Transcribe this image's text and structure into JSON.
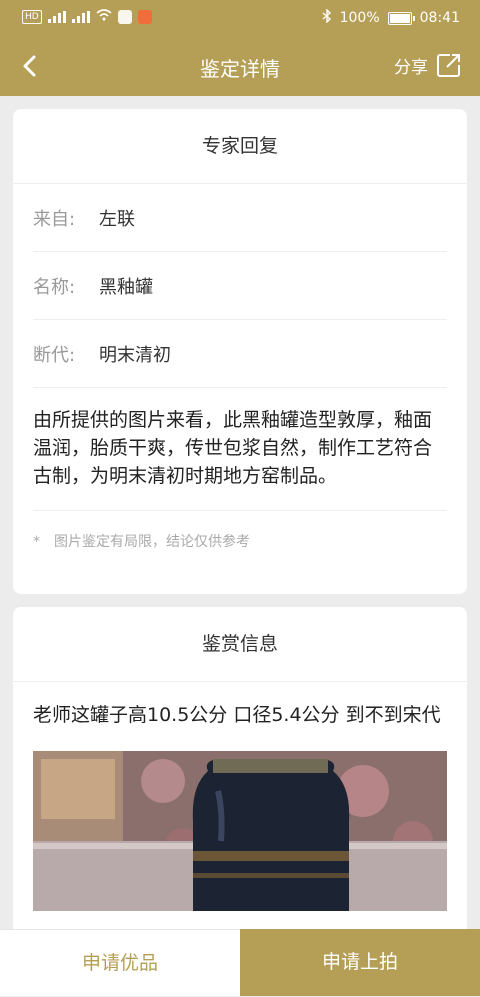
{
  "status_bar": {
    "battery": "100%",
    "time": "08:41",
    "network_label": "4G"
  },
  "header": {
    "title": "鉴定详情",
    "share_label": "分享"
  },
  "expert_reply": {
    "title": "专家回复",
    "rows": [
      {
        "key": "来自:",
        "value": "左联"
      },
      {
        "key": "名称:",
        "value": "黑釉罐"
      },
      {
        "key": "断代:",
        "value": "明末清初"
      }
    ],
    "description": "由所提供的图片来看，此黑釉罐造型敦厚，釉面温润，胎质干爽，传世包浆自然，制作工艺符合古制，为明末清初时期地方窑制品。",
    "note_star": "*",
    "note": "图片鉴定有局限，结论仅供参考"
  },
  "appreciation": {
    "title": "鉴赏信息",
    "question": "老师这罐子高10.5公分 口径5.4公分 到不到宋代"
  },
  "bottom_bar": {
    "left_label": "申请优品",
    "right_label": "申请上拍"
  },
  "colors": {
    "brand": "#b59f56",
    "background": "#ececec"
  }
}
